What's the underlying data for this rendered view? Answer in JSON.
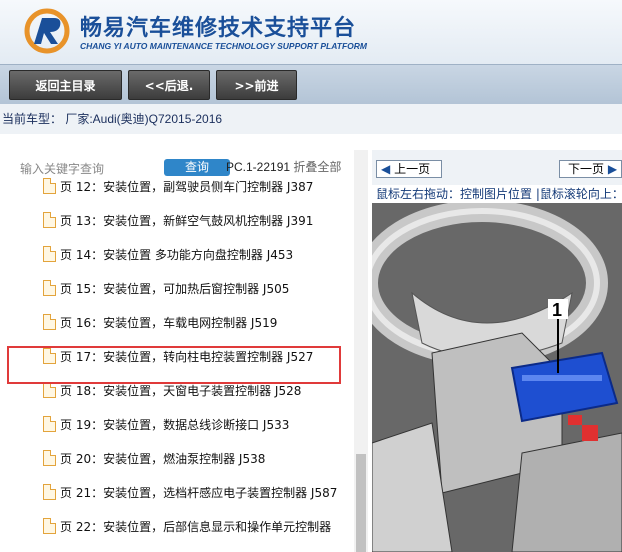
{
  "header": {
    "title_cn": "畅易汽车维修技术支持平台",
    "title_en": "CHANG YI AUTO MAINTENANCE TECHNOLOGY SUPPORT PLATFORM",
    "brand_color": "#1a4f99"
  },
  "toolbar": {
    "home_label": "返回主目录",
    "back_label": "<<后退.",
    "forward_label": ">>前进"
  },
  "infobar": {
    "vehicle_text": "当前车型： 厂家:Audi(奥迪)Q72015-2016"
  },
  "search": {
    "placeholder": "输入关键字查询",
    "button_label": "查询",
    "pc_code": "PC.1-22191",
    "collapse_label": "折叠全部"
  },
  "list": {
    "items": [
      {
        "label": "页 12：安装位置，副驾驶员侧车门控制器 J387"
      },
      {
        "label": "页 13：安装位置，新鲜空气鼓风机控制器 J391"
      },
      {
        "label": "页 14：安装位置 多功能方向盘控制器 J453"
      },
      {
        "label": "页 15：安装位置，可加热后窗控制器 J505"
      },
      {
        "label": "页 16：安装位置，车载电网控制器 J519"
      },
      {
        "label": "页 17：安装位置，转向柱电控装置控制器 J527"
      },
      {
        "label": "页 18：安装位置，天窗电子装置控制器 J528"
      },
      {
        "label": "页 19：安装位置，数据总线诊断接口 J533"
      },
      {
        "label": "页 20：安装位置，燃油泵控制器 J538"
      },
      {
        "label": "页 21：安装位置，选档杆感应电子装置控制器 J587"
      },
      {
        "label": "页 22：安装位置，后部信息显示和操作单元控制器"
      }
    ],
    "highlighted_index": 5,
    "highlight_color": "#e03a3a"
  },
  "viewer": {
    "prev_label": "上一页",
    "next_label": "下一页",
    "hint_text": "鼠标左右拖动：控制图片位置 |鼠标滚轮向上：放大",
    "callout_number": "1"
  }
}
